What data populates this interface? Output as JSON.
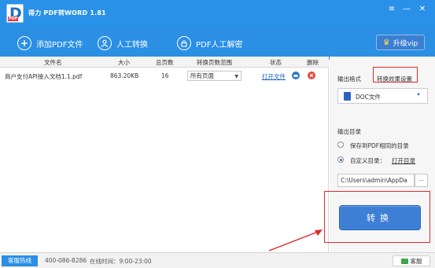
{
  "window": {
    "title": "得力 PDF转WORD 1.81",
    "logo_letter": "D",
    "logo_badge": "PDF",
    "controls": {
      "menu": "≡",
      "minimize": "—",
      "close": "✕"
    }
  },
  "toolbar": {
    "add_pdf": {
      "icon": "plus",
      "label": "添加PDF文件"
    },
    "manual_convert": {
      "icon": "person",
      "label": "人工转换"
    },
    "pdf_decrypt": {
      "icon": "lock",
      "label": "PDF人工解密"
    },
    "vip": {
      "icon": "crown",
      "label": "升级vip"
    }
  },
  "table": {
    "headers": [
      "文件名",
      "大小",
      "总页数",
      "转换页数范围",
      "状态",
      "删除"
    ],
    "rows": [
      {
        "filename": "商户支付API接入文档1.1.pdf",
        "size": "863.20KB",
        "pages": "16",
        "range": "所有页面",
        "action": "打开文件"
      }
    ]
  },
  "panel": {
    "output_format_label": "输出格式",
    "effect_settings_link": "转换效果设置",
    "format_value": "DOC文件",
    "output_dir_label": "输出目录",
    "option_same_dir": "保存到PDF相同的目录",
    "option_custom_dir": "自定义目录：",
    "open_dir_link": "打开目录",
    "path_value": "C:\\Users\\admin\\AppDa",
    "browse_label": "...",
    "convert_label": "转换"
  },
  "statusbar": {
    "hotline_label": "客服热线",
    "phone": "400-086-8286",
    "hours": "在线时间：9:00-23:00",
    "cs_label": "客服"
  },
  "colors": {
    "titlebar": "#2a91e8",
    "toolbar": "#2b8fe4",
    "convert_button": "#3e7fd6",
    "annotation_red": "#e02a2a",
    "link_blue": "#1a5fc2",
    "link_orange": "#e07a1a"
  }
}
